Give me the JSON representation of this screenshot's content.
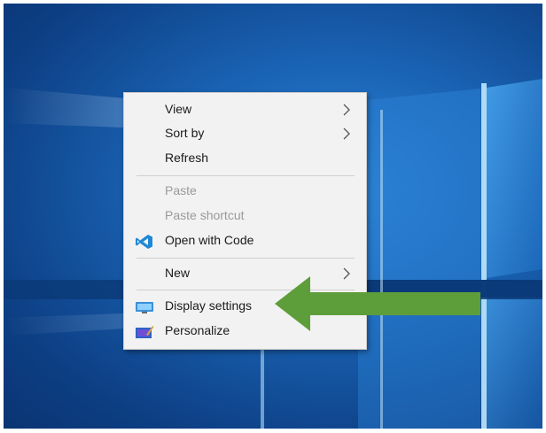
{
  "context_menu": {
    "items": [
      {
        "label": "View",
        "has_submenu": true,
        "disabled": false
      },
      {
        "label": "Sort by",
        "has_submenu": true,
        "disabled": false
      },
      {
        "label": "Refresh",
        "has_submenu": false,
        "disabled": false
      },
      {
        "label": "Paste",
        "has_submenu": false,
        "disabled": true
      },
      {
        "label": "Paste shortcut",
        "has_submenu": false,
        "disabled": true
      },
      {
        "label": "Open with Code",
        "has_submenu": false,
        "disabled": false,
        "icon": "vscode-icon"
      },
      {
        "label": "New",
        "has_submenu": true,
        "disabled": false
      },
      {
        "label": "Display settings",
        "has_submenu": false,
        "disabled": false,
        "icon": "display-icon"
      },
      {
        "label": "Personalize",
        "has_submenu": false,
        "disabled": false,
        "icon": "personalize-icon"
      }
    ]
  },
  "annotation": {
    "shape": "left-pointing-arrow",
    "target": "Display settings",
    "color": "#5e9e3a"
  },
  "desktop": {
    "wallpaper": "windows-10-light-beams",
    "accent": "#1a63b4"
  }
}
